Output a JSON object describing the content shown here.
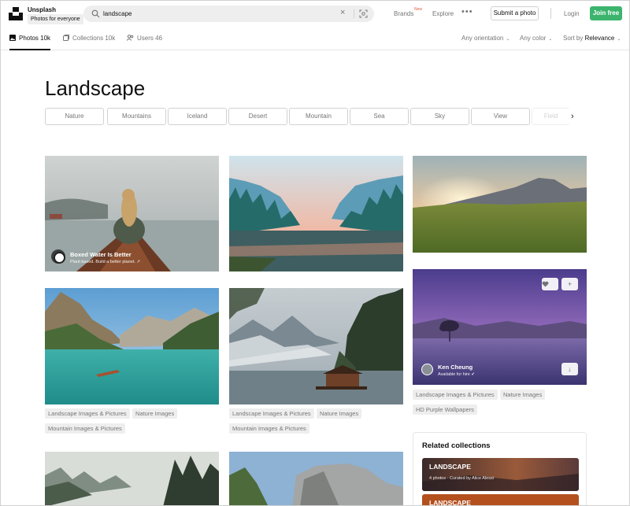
{
  "header": {
    "brand_name": "Unsplash",
    "brand_tagline": "Photos for everyone",
    "search_value": "landscape",
    "nav": {
      "brands": "Brands",
      "brands_badge": "New",
      "explore": "Explore"
    },
    "submit_label": "Submit a photo",
    "login_label": "Login",
    "join_label": "Join free"
  },
  "subnav": {
    "tabs": [
      {
        "label": "Photos 10k",
        "icon": "photo-icon"
      },
      {
        "label": "Collections 10k",
        "icon": "collections-icon"
      },
      {
        "label": "Users 46",
        "icon": "users-icon"
      }
    ],
    "orientation": "Any orientation",
    "color": "Any color",
    "sort_prefix": "Sort by",
    "sort_value": "Relevance"
  },
  "page_title": "Landscape",
  "chips": [
    "Nature",
    "Mountains",
    "Iceland",
    "Desert",
    "Mountain",
    "Sea",
    "Sky",
    "View",
    "Field"
  ],
  "photos": {
    "boat_girl": {
      "author": "Boxed Water Is Better",
      "subtitle": "Plant-based. Build a better planet. ↗"
    },
    "lake_purple": {
      "author": "Ken Cheung",
      "subtitle": "Available for hire ✔",
      "tags": [
        "Landscape Images & Pictures",
        "Nature Images",
        "HD Purple Wallpapers"
      ]
    },
    "lake_teal": {
      "tags": [
        "Landscape Images & Pictures",
        "Nature Images",
        "Mountain Images & Pictures"
      ]
    },
    "cabin_lake": {
      "tags": [
        "Landscape Images & Pictures",
        "Nature Images",
        "Mountain Images & Pictures"
      ]
    }
  },
  "related": {
    "heading": "Related collections",
    "items": [
      {
        "title": "LANDSCAPE",
        "subtitle": "4 photos · Curated by Alice Alessi"
      },
      {
        "title": "LANDSCAPE",
        "subtitle": ""
      }
    ]
  },
  "colors": {
    "accent_green": "#3cb46e",
    "badge_red": "#e25c3d"
  }
}
